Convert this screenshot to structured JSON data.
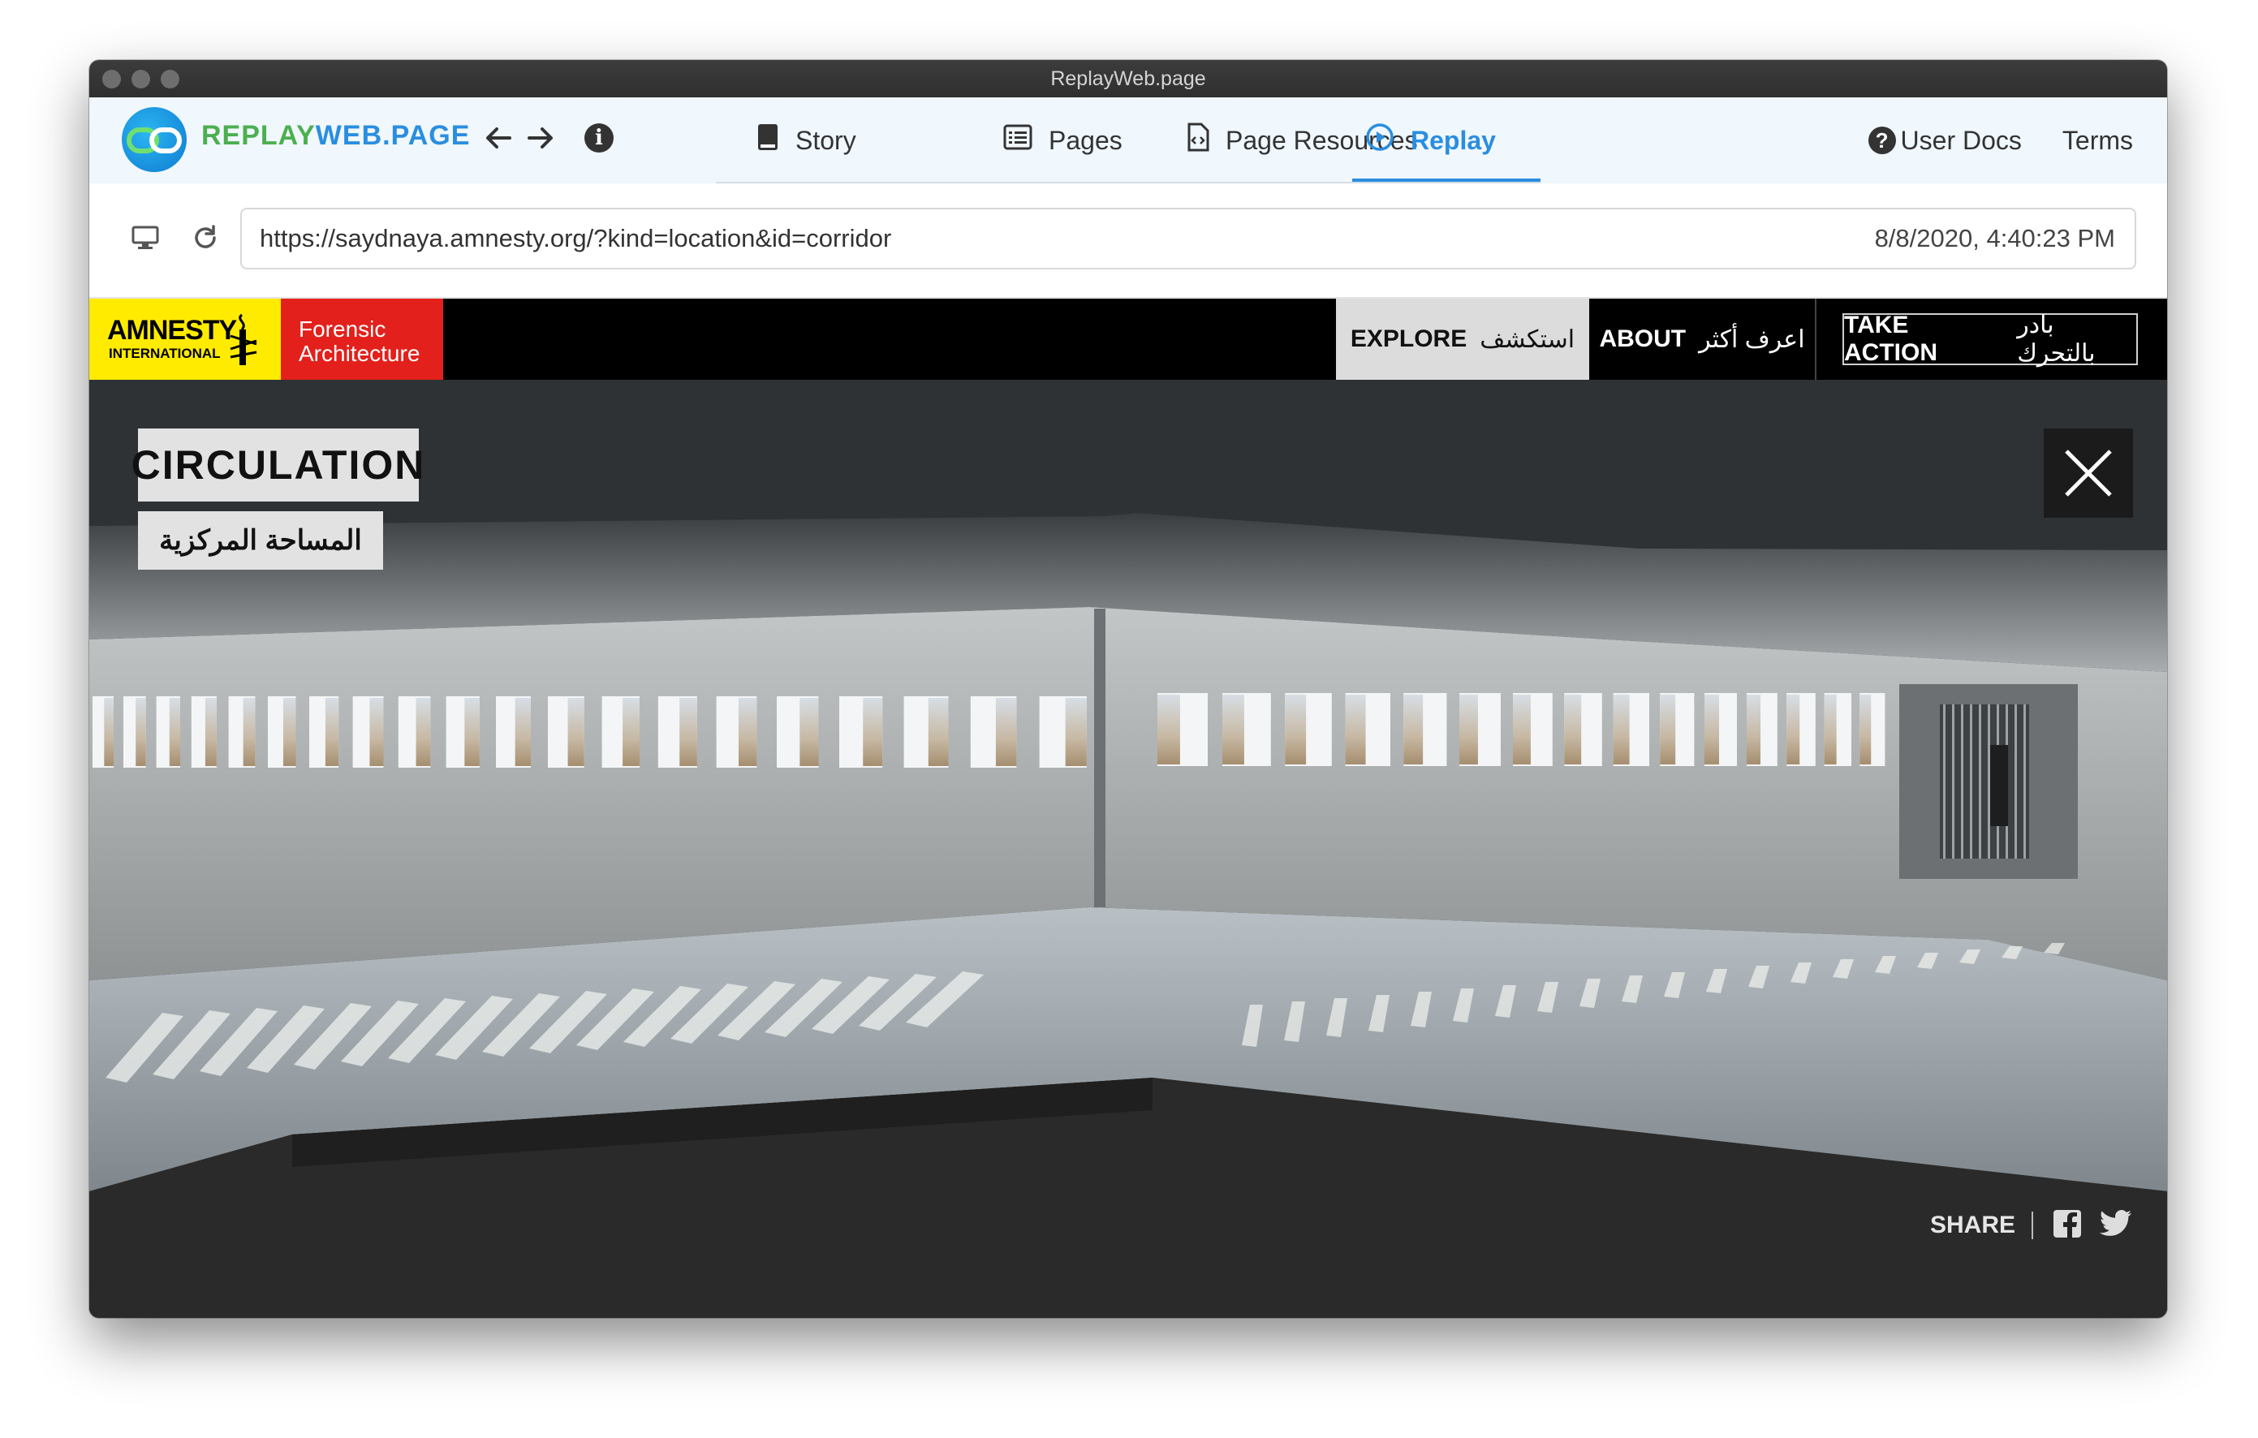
{
  "window": {
    "title": "ReplayWeb.page"
  },
  "app": {
    "brand_part1": "REPLAY",
    "brand_part2": "WEB.PAGE",
    "tabs": [
      {
        "label": "Story",
        "icon": "book-icon"
      },
      {
        "label": "Pages",
        "icon": "list-icon"
      },
      {
        "label": "Page Resources",
        "icon": "file-code-icon"
      },
      {
        "label": "Replay",
        "icon": "play-circle-icon",
        "active": true
      }
    ],
    "links": {
      "user_docs": "User Docs",
      "terms": "Terms"
    },
    "accent_color": "#2a8ee0"
  },
  "address": {
    "url": "https://saydnaya.amnesty.org/?kind=location&id=corridor",
    "timestamp": "8/8/2020, 4:40:23 PM"
  },
  "site": {
    "amnesty_line1": "AMNESTY",
    "amnesty_line2": "INTERNATIONAL",
    "fa_line1": "Forensic",
    "fa_line2": "Architecture",
    "menu": {
      "explore_en": "EXPLORE",
      "explore_ar": "استكشف",
      "about_en": "ABOUT",
      "about_ar": "اعرف أكثر",
      "action_en": "TAKE ACTION",
      "action_ar": "بادر بالتحرك"
    },
    "location_title": "CIRCULATION",
    "location_title_ar": "المساحة المركزية",
    "share_label": "SHARE",
    "colors": {
      "amnesty_yellow": "#ffeb00",
      "fa_red": "#e3201b"
    }
  }
}
